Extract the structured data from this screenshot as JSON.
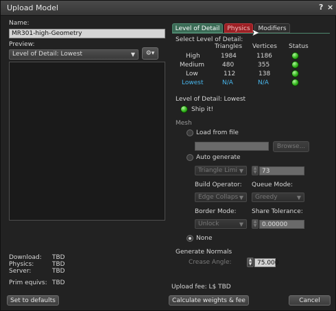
{
  "window": {
    "title": "Upload Model",
    "help_label": "?",
    "close_label": "×"
  },
  "left": {
    "name_label": "Name:",
    "name_value": "MR301-high-Geometry",
    "preview_label": "Preview:",
    "preview_select": "Level of Detail: Lowest",
    "costs": [
      {
        "label": "Download:",
        "value": "TBD"
      },
      {
        "label": "Physics:",
        "value": "TBD"
      },
      {
        "label": "Server:",
        "value": "TBD"
      }
    ],
    "prim_label": "Prim equivs:",
    "prim_value": "TBD",
    "defaults_button": "Set to defaults"
  },
  "tabs": [
    {
      "label": "Level of Detail"
    },
    {
      "label": "Physics"
    },
    {
      "label": "Modifiers"
    }
  ],
  "lod": {
    "select_label": "Select Level of Detail:",
    "headers": {
      "triangles": "Triangles",
      "vertices": "Vertices",
      "status": "Status"
    },
    "rows": [
      {
        "name": "High",
        "triangles": "1984",
        "vertices": "1186"
      },
      {
        "name": "Medium",
        "triangles": "480",
        "vertices": "355"
      },
      {
        "name": "Low",
        "triangles": "112",
        "vertices": "138"
      },
      {
        "name": "Lowest",
        "triangles": "N/A",
        "vertices": "N/A"
      }
    ],
    "status_color": "#32b51c",
    "selected_color": "#48b6ec",
    "current_label": "Level of Detail: Lowest",
    "ship_label": "Ship it!",
    "mesh_label": "Mesh",
    "load_from_file": "Load from file",
    "browse_button": "Browse...",
    "auto_generate": "Auto generate",
    "triangle_limit_select": "Triangle Limi",
    "triangle_limit_value": "73",
    "build_operator_label": "Build Operator:",
    "queue_mode_label": "Queue Mode:",
    "build_operator_select": "Edge Collaps",
    "queue_mode_select": "Greedy",
    "border_mode_label": "Border Mode:",
    "share_tolerance_label": "Share Tolerance:",
    "border_mode_select": "Unlock",
    "share_tolerance_value": "0.00000",
    "none_label": "None",
    "normals_label": "Generate Normals",
    "crease_label": "Crease Angle:",
    "crease_value": "75.000"
  },
  "footer": {
    "upload_fee": "Upload fee: L$ TBD",
    "calculate_button": "Calculate weights & fee",
    "cancel_button": "Cancel"
  }
}
